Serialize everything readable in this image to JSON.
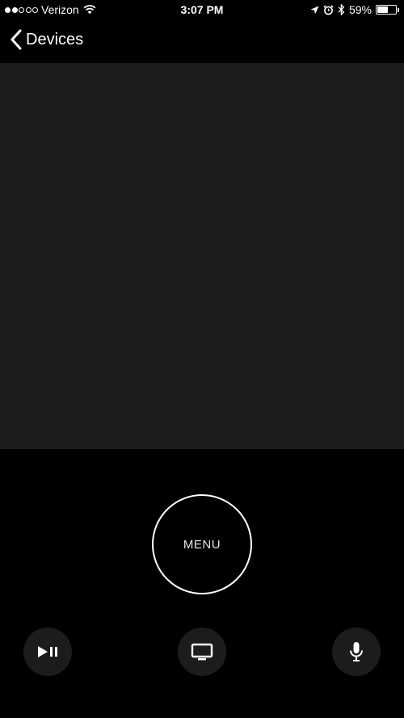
{
  "status_bar": {
    "carrier": "Verizon",
    "signal_bars_filled": 2,
    "signal_bars_total": 5,
    "time": "3:07 PM",
    "battery_percent": "59%",
    "battery_level": 0.59
  },
  "nav": {
    "back_label": "Devices"
  },
  "remote": {
    "menu_label": "MENU"
  },
  "icons": {
    "back": "chevron-left-icon",
    "play_pause": "play-pause-icon",
    "tv": "tv-icon",
    "mic": "microphone-icon",
    "wifi": "wifi-icon",
    "location": "location-arrow-icon",
    "alarm": "alarm-clock-icon",
    "bluetooth": "bluetooth-icon"
  },
  "colors": {
    "background": "#000000",
    "touch_surface": "#1c1c1e",
    "button_bg": "#1c1c1e",
    "foreground": "#ffffff"
  }
}
